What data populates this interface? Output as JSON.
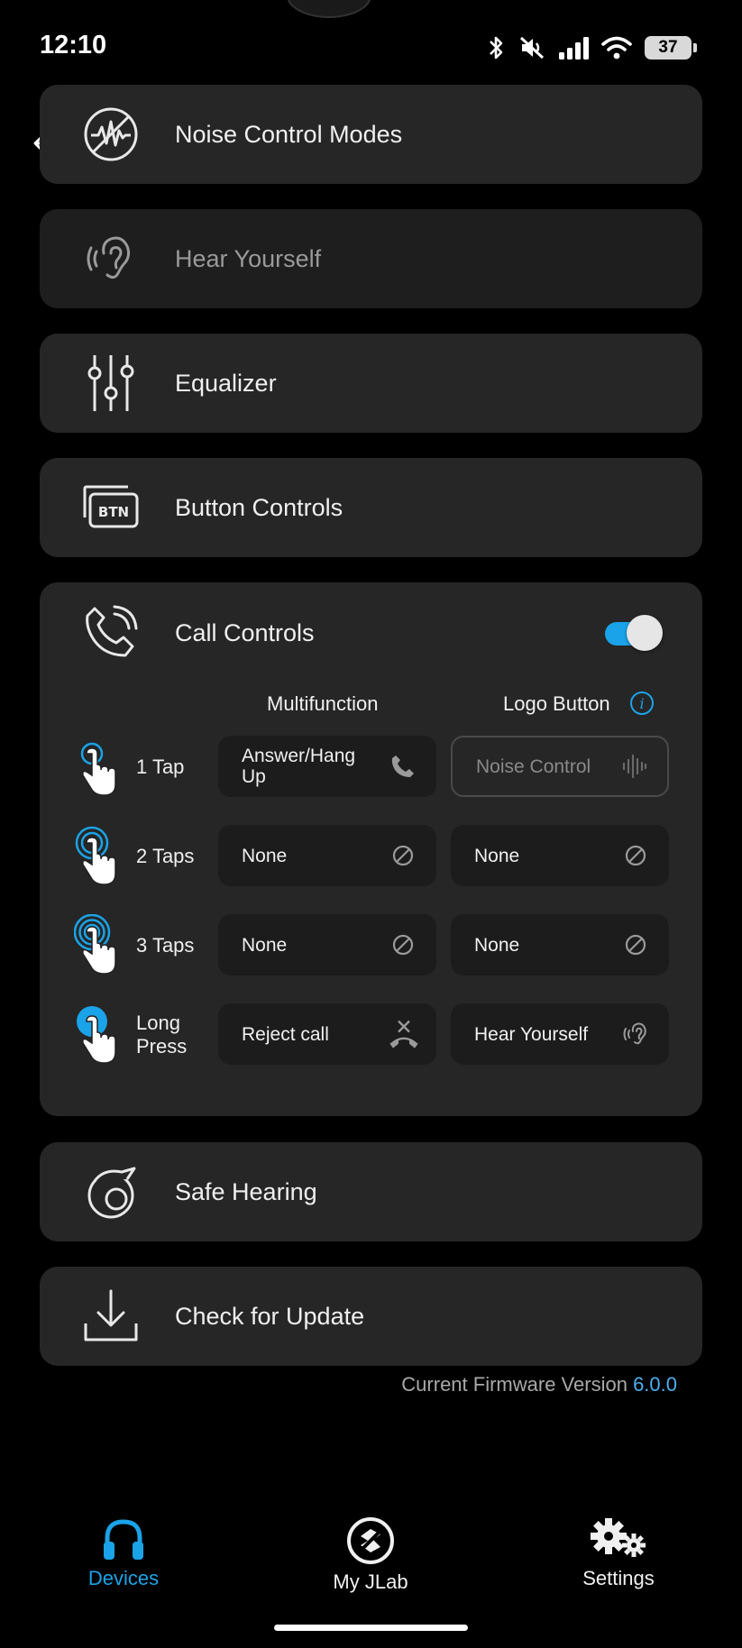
{
  "status": {
    "time": "12:10",
    "battery": "37"
  },
  "menu": {
    "noise_control": "Noise Control Modes",
    "hear_yourself": "Hear Yourself",
    "equalizer": "Equalizer",
    "button_controls": "Button Controls",
    "call_controls": "Call Controls",
    "safe_hearing": "Safe Hearing",
    "check_update": "Check for Update"
  },
  "call_controls": {
    "enabled": true,
    "col_multifunction": "Multifunction",
    "col_logo": "Logo Button",
    "rows": [
      {
        "label": "1 Tap",
        "multi": "Answer/Hang Up",
        "logo": "Noise Control"
      },
      {
        "label": "2 Taps",
        "multi": "None",
        "logo": "None"
      },
      {
        "label": "3 Taps",
        "multi": "None",
        "logo": "None"
      },
      {
        "label": "Long Press",
        "multi": "Reject call",
        "logo": "Hear Yourself"
      }
    ]
  },
  "firmware": {
    "label": "Current Firmware Version",
    "version": "6.0.0"
  },
  "tabs": [
    {
      "label": "Devices",
      "active": true
    },
    {
      "label": "My JLab",
      "active": false
    },
    {
      "label": "Settings",
      "active": false
    }
  ],
  "colors": {
    "accent": "#1aa3e8",
    "card": "#262626",
    "background": "#000000"
  }
}
